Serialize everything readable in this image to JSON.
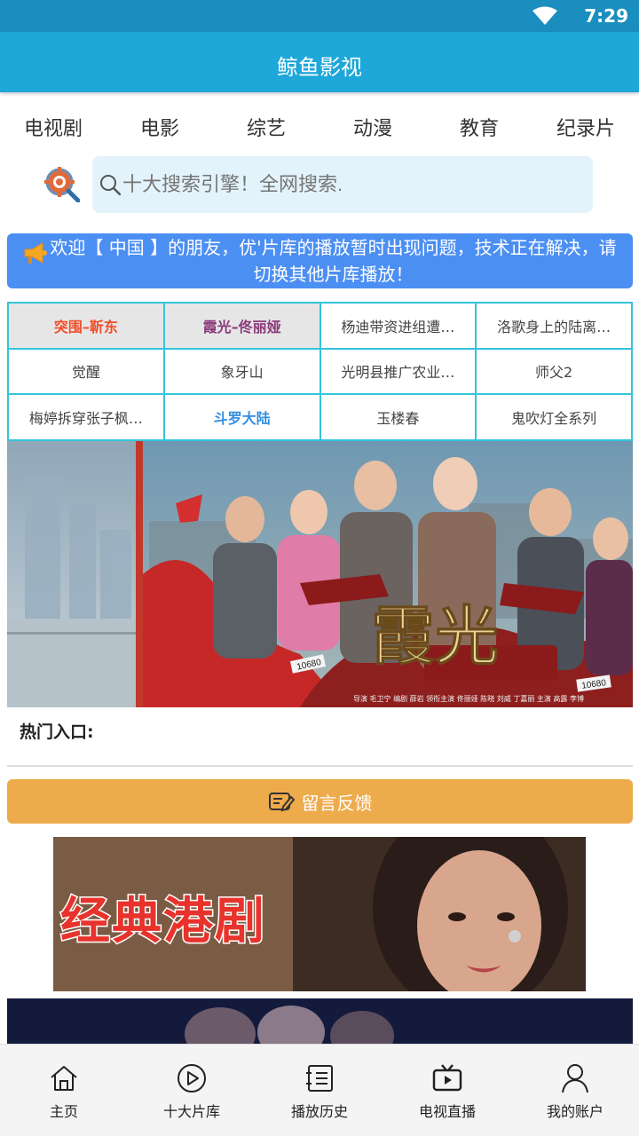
{
  "status_bar": {
    "time": "7:29",
    "wifi_icon": "wifi-icon"
  },
  "app_bar": {
    "title": "鲸鱼影视"
  },
  "categories": [
    "电视剧",
    "电影",
    "综艺",
    "动漫",
    "教育",
    "纪录片"
  ],
  "search": {
    "placeholder": "十大搜索引擎！全网搜索.",
    "logo_icon": "search-gear-icon",
    "icon": "search-icon"
  },
  "notice": {
    "icon": "megaphone-icon",
    "text": "欢迎【 中国 】的朋友，优'片库的播放暂时出现问题，技术正在解决，请切换其他片库播放！"
  },
  "hot_grid": [
    "突围–靳东",
    "霞光–佟丽娅",
    "杨迪带资进组遭…",
    "洛歌身上的陆离…",
    "觉醒",
    "象牙山",
    "光明县推广农业…",
    "师父2",
    "梅婷拆穿张子枫…",
    "斗罗大陆",
    "玉楼春",
    "鬼吹灯全系列"
  ],
  "banner": {
    "title_art": "霞光",
    "credits": "导演 毛卫宁  编剧 薛岩  领衔主演 佟丽娅 陈晓 刘威 丁嘉丽  主演 高露 李博",
    "plate1": "10680",
    "plate2": "10680"
  },
  "hot_entry_label": "热门入口:",
  "feedback": {
    "label": "留言反馈",
    "icon": "edit-note-icon"
  },
  "promo1": {
    "text": "经典港剧"
  },
  "bottom_nav": [
    {
      "label": "主页",
      "icon": "home-icon"
    },
    {
      "label": "十大片库",
      "icon": "play-circle-icon"
    },
    {
      "label": "播放历史",
      "icon": "history-list-icon"
    },
    {
      "label": "电视直播",
      "icon": "tv-icon"
    },
    {
      "label": "我的账户",
      "icon": "user-icon"
    }
  ],
  "colors": {
    "status_bar": "#1a8fbf",
    "app_bar": "#1ea7d9",
    "notice_bg": "#4c8ff3",
    "grid_border": "#34c4da",
    "feedback_bg": "#eeab4c",
    "grid_red": "#f04e2a",
    "grid_purple": "#8a3a7a",
    "grid_blue": "#2f8ee0"
  }
}
